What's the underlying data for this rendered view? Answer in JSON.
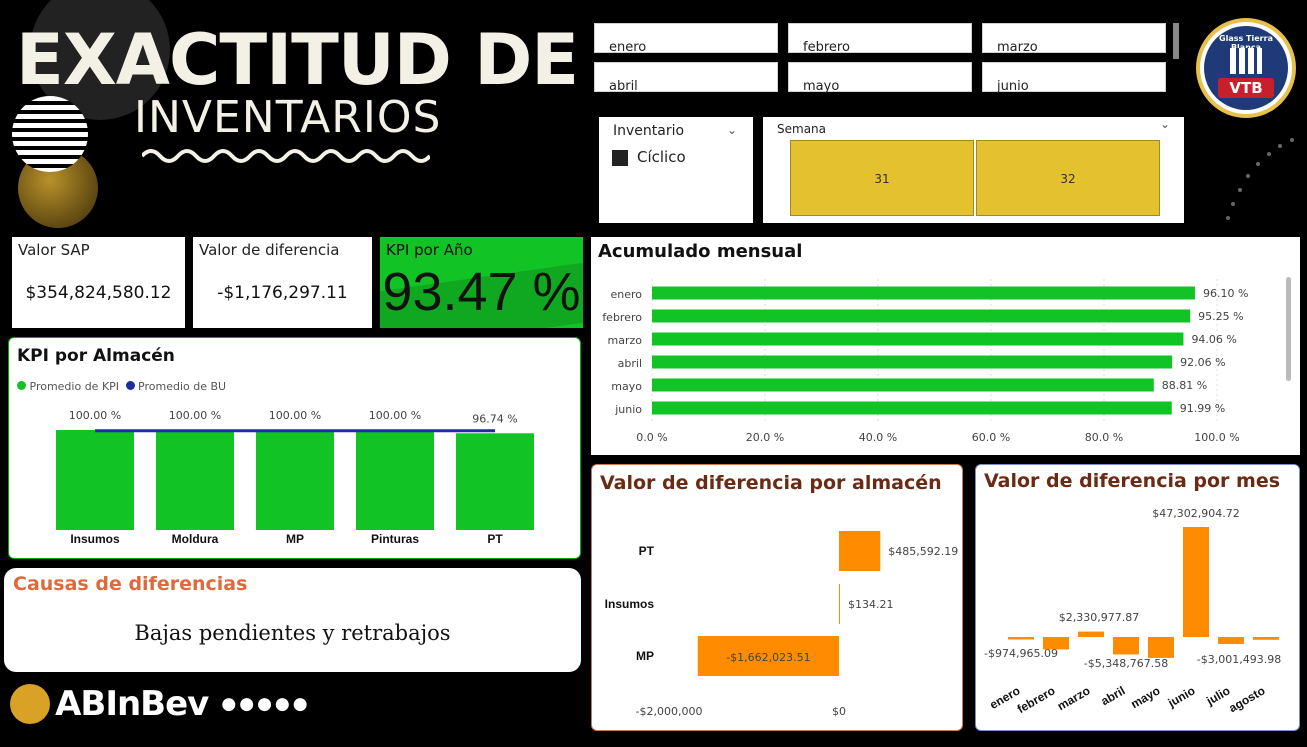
{
  "header": {
    "title_line1": "EXACTITUD DE",
    "title_line2": "INVENTARIOS"
  },
  "months": [
    "enero",
    "febrero",
    "marzo",
    "abril",
    "mayo",
    "junio"
  ],
  "inventario": {
    "label": "Inventario",
    "option": "Cíclico"
  },
  "semana": {
    "label": "Semana",
    "options": [
      "31",
      "32"
    ]
  },
  "logo_vtb": {
    "text": "Glass Tierra Blanca",
    "initials": "VTB"
  },
  "kpis": {
    "valor_sap": {
      "label": "Valor SAP",
      "value": "$354,824,580.12"
    },
    "valor_diferencia": {
      "label": "Valor de diferencia",
      "value": "-$1,176,297.11"
    },
    "kpi_anio": {
      "label": "KPI por Año",
      "value": "93.47 %"
    }
  },
  "kpi_almacen": {
    "title": "KPI por Almacén",
    "legend": [
      {
        "name": "Promedio de KPI",
        "color": "#12c326"
      },
      {
        "name": "Promedio de BU",
        "color": "#1d2f9c"
      }
    ],
    "chart_data": {
      "type": "bar",
      "categories": [
        "Insumos",
        "Moldura",
        "MP",
        "Pinturas",
        "PT"
      ],
      "series": [
        {
          "name": "Promedio de KPI",
          "values": [
            100.0,
            100.0,
            100.0,
            100.0,
            96.74
          ]
        },
        {
          "name": "Promedio de BU",
          "values": [
            99.3,
            99.3,
            99.3,
            99.3,
            99.3
          ]
        }
      ],
      "labels": [
        "100.00 %",
        "100.00 %",
        "100.00 %",
        "100.00 %",
        "96.74 %"
      ],
      "ylim": [
        0,
        100
      ]
    }
  },
  "causas": {
    "title": "Causas de diferencias",
    "text": "Bajas pendientes y retrabajos"
  },
  "abinbev": {
    "brand": "ABInBev",
    "dots": "●●●●●"
  },
  "acumulado": {
    "title": "Acumulado mensual",
    "chart_data": {
      "type": "bar",
      "categories": [
        "enero",
        "febrero",
        "marzo",
        "abril",
        "mayo",
        "junio"
      ],
      "values": [
        96.1,
        95.25,
        94.06,
        92.06,
        88.81,
        91.99
      ],
      "labels": [
        "96.10 %",
        "95.25 %",
        "94.06 %",
        "92.06 %",
        "88.81 %",
        "91.99 %"
      ],
      "xticks": [
        "0.0 %",
        "20.0 %",
        "40.0 %",
        "60.0 %",
        "80.0 %",
        "100.0 %"
      ],
      "xlim": [
        0,
        100
      ]
    }
  },
  "dif_almacen": {
    "title": "Valor de diferencia por almacén",
    "chart_data": {
      "type": "bar",
      "categories": [
        "PT",
        "Insumos",
        "MP"
      ],
      "values": [
        485592.19,
        134.21,
        -1662023.51
      ],
      "labels": [
        "$485,592.19",
        "$134.21",
        "-$1,662,023.51"
      ],
      "xticks": [
        "-$2,000,000",
        "$0"
      ],
      "xlim": [
        -2000000,
        500000
      ]
    }
  },
  "dif_mes": {
    "title": "Valor de diferencia por mes",
    "chart_data": {
      "type": "bar",
      "categories": [
        "enero",
        "febrero",
        "marzo",
        "abril",
        "mayo",
        "junio",
        "julio",
        "agosto"
      ],
      "values": [
        -974965.09,
        -5348767.58,
        2330977.87,
        -7500000,
        -9000000,
        47302904.72,
        -3001493.98,
        -1200000
      ],
      "labels": [
        "-$974,965.09",
        "",
        "$2,330,977.87",
        "-$5,348,767.58",
        "",
        "$47,302,904.72",
        "-$3,001,493.98",
        ""
      ]
    }
  },
  "colors": {
    "green": "#12c326",
    "orange": "#ff8c00",
    "gold": "#e3c12f",
    "navy": "#1d2f9c",
    "brown": "#6b2a13",
    "causas_title": "#e0693c"
  }
}
